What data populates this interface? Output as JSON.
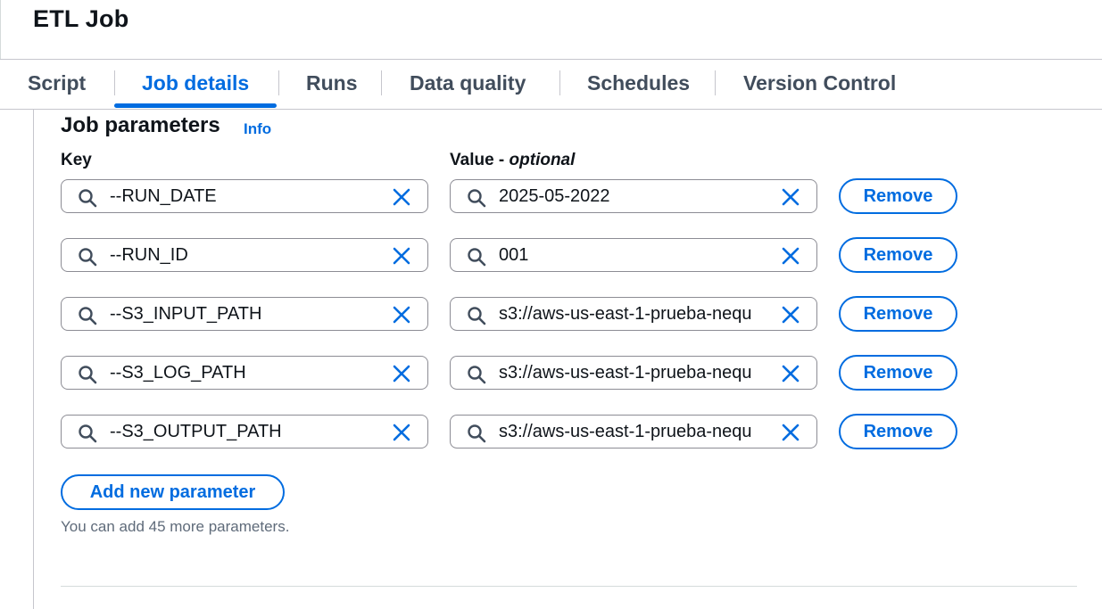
{
  "header": {
    "title": "ETL Job"
  },
  "tabs": [
    {
      "label": "Script",
      "active": false
    },
    {
      "label": "Job details",
      "active": true
    },
    {
      "label": "Runs",
      "active": false
    },
    {
      "label": "Data quality",
      "active": false
    },
    {
      "label": "Schedules",
      "active": false
    },
    {
      "label": "Version Control",
      "active": false
    }
  ],
  "job_parameters": {
    "title": "Job parameters",
    "info_link": "Info",
    "key_label": "Key",
    "value_label": "Value -",
    "value_label_optional": "optional",
    "rows": [
      {
        "key": "--RUN_DATE",
        "value": "2025-05-2022"
      },
      {
        "key": "--RUN_ID",
        "value": "001"
      },
      {
        "key": "--S3_INPUT_PATH",
        "value": "s3://aws-us-east-1-prueba-nequ"
      },
      {
        "key": "--S3_LOG_PATH",
        "value": "s3://aws-us-east-1-prueba-nequ"
      },
      {
        "key": "--S3_OUTPUT_PATH",
        "value": "s3://aws-us-east-1-prueba-nequ"
      }
    ],
    "remove_label": "Remove",
    "add_label": "Add new parameter",
    "hint": "You can add 45 more parameters."
  },
  "colors": {
    "accent": "#006ce0",
    "border": "#8c8c94",
    "text": "#0f141a"
  },
  "icons": {
    "search": "search-icon",
    "clear": "close-icon"
  }
}
